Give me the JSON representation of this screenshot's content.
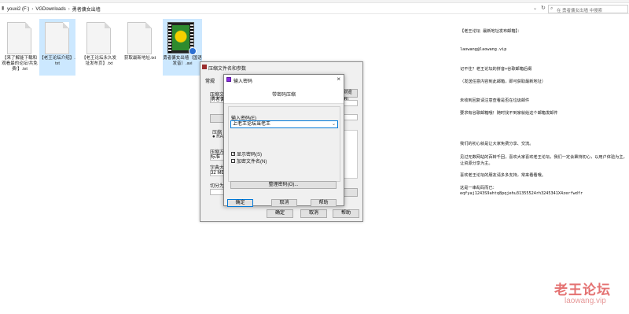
{
  "explorer": {
    "breadcrumb": [
      "youxi2 (F:)",
      "VGDownloads",
      "勇者傭女出墙"
    ],
    "search_placeholder": "在 勇者傭女出墙 中搜索"
  },
  "files": [
    {
      "name": "【来了解能下载和观看最的论坛!共免费!】.txt"
    },
    {
      "name": "【老王论坛介绍】.txt"
    },
    {
      "name": "【老王论坛永久发址发布页】.txt"
    },
    {
      "name": "获取最新地址.txt"
    },
    {
      "name": "勇者傭女出墙（国语发音）.avi"
    }
  ],
  "back_dialog": {
    "title": "压缩文件名和参数",
    "tab": "常规",
    "labels": {
      "compress_name": "压缩文",
      "profile": "配置",
      "update": "更新方",
      "compress_format": "压缩",
      "rar": "RA",
      "method": "压缩方",
      "method_value": "标准",
      "dict": "字典大",
      "dict_value": "32 MB",
      "split": "切分为"
    },
    "buttons": {
      "browse": "浏览(B)...",
      "ok": "确定",
      "cancel": "取消",
      "help": "帮助"
    },
    "field_value": "勇者傭"
  },
  "front_dialog": {
    "title": "输入密码",
    "heading": "带密码压缩",
    "label": "输入密码(E)",
    "password": "上老王论坛当老王",
    "check1": "显示密码(S)",
    "check2": "加密文件名(N)",
    "organize_button": "整理密码(O)...",
    "ok": "确定",
    "cancel": "取消",
    "help": "帮助"
  },
  "notice_lines": [
    "【老王论坛 最新地址发布邮箱】：",
    "laowang@laowang.vip",
    "记不住？老王论坛的拼音+谷歌邮箱后缀",
    "（发送任意内容到此邮箱，即可获取最新地址）",
    "未收到回复请注意查看是否在垃圾邮件",
    "要求有谷歌邮箱哦！随时找不到家就给这个邮箱发邮件",
    "我们的初心就是让大家免费分享、交流。",
    "见过无数网站的百转千回，喜欢大家喜欢老王论坛，我们一定会秉持初心，以用户体验为主，让资源分享为主。",
    "喜欢老王论坛的朋友请多多支持，常来看看哦。",
    "这是一串乱码而已：",
    "eqfyaj1243S9ahtq8pqjehu31355524rh3245341X4zerfwdfr"
  ],
  "watermark": {
    "cn": "老王论坛",
    "en": "laowang.vip"
  },
  "colors": {
    "accent": "#0078d7",
    "watermark": "#e05a5a",
    "selection": "#cce8ff"
  }
}
